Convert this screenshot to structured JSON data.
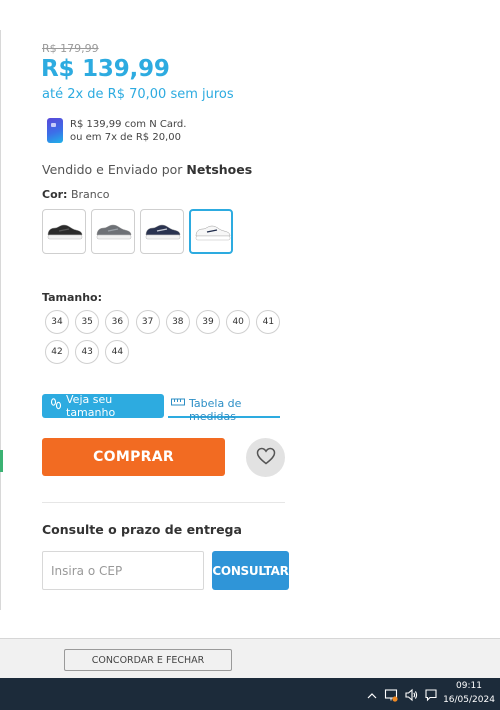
{
  "product": {
    "old_price": "R$ 179,99",
    "price": "R$ 139,99",
    "installments": "até 2x de R$ 70,00 sem juros",
    "ncard_line1": "R$ 139,99 com N Card.",
    "ncard_line2": "ou em 7x de R$ 20,00",
    "seller_prefix": "Vendido e Enviado por ",
    "seller_name": "Netshoes"
  },
  "color": {
    "label": "Cor:",
    "selected": "Branco",
    "swatches": [
      {
        "name": "preto",
        "upper": "#2b2b2b",
        "sole": "#f2f2f2",
        "accent": "#555555"
      },
      {
        "name": "cinza",
        "upper": "#6e7176",
        "sole": "#f2f2f2",
        "accent": "#9aa0a6"
      },
      {
        "name": "marinho",
        "upper": "#2a3350",
        "sole": "#f4f4f4",
        "accent": "#c8ccd6"
      },
      {
        "name": "branco",
        "upper": "#f7f7f7",
        "sole": "#ffffff",
        "accent": "#1e2a4a"
      }
    ]
  },
  "size": {
    "label": "Tamanho:",
    "options": [
      "34",
      "35",
      "36",
      "37",
      "38",
      "39",
      "40",
      "41",
      "42",
      "43",
      "44"
    ]
  },
  "size_help": {
    "veja_label": "Veja seu tamanho",
    "tabela_label": "Tabela de medidas"
  },
  "buy": {
    "label": "COMPRAR"
  },
  "delivery": {
    "title": "Consulte o prazo de entrega",
    "placeholder": "Insira o CEP",
    "button": "CONSULTAR"
  },
  "cookie": {
    "button": "CONCORDAR E FECHAR"
  },
  "taskbar": {
    "time": "09:11",
    "date": "16/05/2024"
  },
  "colors": {
    "accent": "#2dabe0",
    "buy": "#f26b22",
    "consult": "#2f95d8",
    "taskbar": "#1c2b3a"
  }
}
